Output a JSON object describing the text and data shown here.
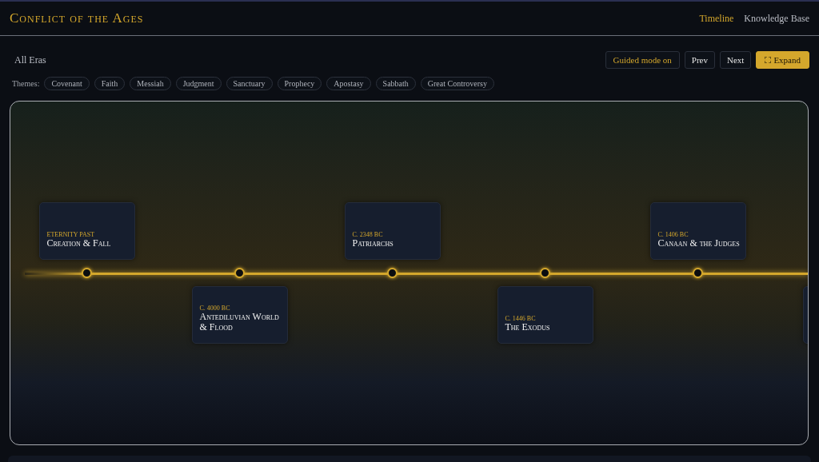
{
  "app_title": "Conflict of the Ages",
  "nav": [
    {
      "label": "Timeline",
      "selected": true
    },
    {
      "label": "Knowledge Base",
      "selected": false
    }
  ],
  "era_filter": "All Eras",
  "controls": {
    "guided": "Guided mode on",
    "prev": "Prev",
    "next": "Next",
    "expand": "Expand"
  },
  "themes_label": "Themes:",
  "themes": [
    "Covenant",
    "Faith",
    "Messiah",
    "Judgment",
    "Sanctuary",
    "Prophecy",
    "Apostasy",
    "Sabbath",
    "Great Controversy"
  ],
  "events": [
    {
      "kind": "event",
      "date": "ETERNITY PAST",
      "title": "Creation & Fall"
    },
    {
      "kind": "event",
      "date": "C. 4000 BC",
      "title": "Antediluvian World & Flood"
    },
    {
      "kind": "event",
      "date": "C. 2348 BC",
      "title": "Patriarchs"
    },
    {
      "kind": "event",
      "date": "C. 1446 BC",
      "title": "The Exodus"
    },
    {
      "kind": "event",
      "date": "C. 1406 BC",
      "title": "Canaan & the Judges"
    },
    {
      "kind": "stub"
    }
  ]
}
